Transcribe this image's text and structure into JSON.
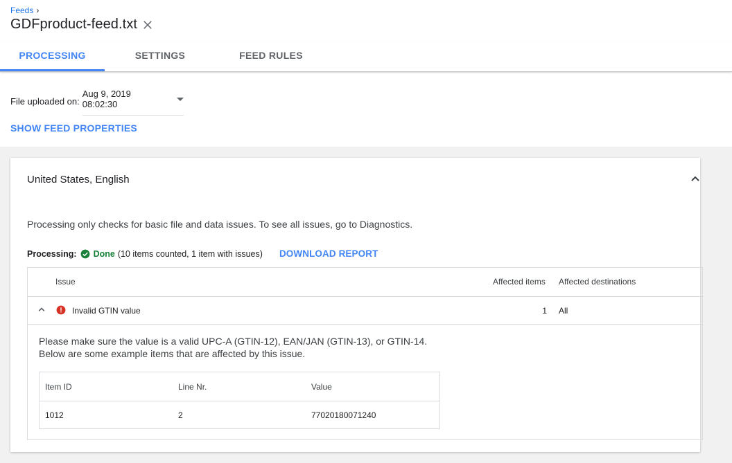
{
  "breadcrumb": {
    "parent": "Feeds",
    "separator": "›"
  },
  "page": {
    "title": "GDFproduct-feed.txt"
  },
  "tabs": [
    {
      "label": "PROCESSING",
      "active": true
    },
    {
      "label": "SETTINGS",
      "active": false
    },
    {
      "label": "FEED RULES",
      "active": false
    }
  ],
  "upload": {
    "label": "File uploaded on:",
    "selected": "Aug 9, 2019 08:02:30"
  },
  "show_properties_label": "SHOW FEED PROPERTIES",
  "card": {
    "title": "United States, English",
    "note": "Processing only checks for basic file and data issues. To see all issues, go to Diagnostics.",
    "processing": {
      "label": "Processing:",
      "status": "Done",
      "summary": "(10 items counted, 1 item with issues)",
      "download_label": "DOWNLOAD REPORT"
    },
    "issues_table": {
      "headers": {
        "issue": "Issue",
        "affected_items": "Affected items",
        "affected_destinations": "Affected destinations"
      },
      "rows": [
        {
          "issue": "Invalid GTIN value",
          "affected_items": "1",
          "affected_destinations": "All",
          "detail_line1": "Please make sure the value is a valid UPC-A (GTIN-12), EAN/JAN (GTIN-13), or GTIN-14.",
          "detail_line2": "Below are some example items that are affected by this issue.",
          "examples": {
            "headers": {
              "item_id": "Item ID",
              "line_nr": "Line Nr.",
              "value": "Value"
            },
            "rows": [
              {
                "item_id": "1012",
                "line_nr": "2",
                "value": "77020180071240"
              }
            ]
          }
        }
      ]
    }
  },
  "colors": {
    "accent": "#4285f4",
    "link": "#1a73e8",
    "success": "#188038",
    "error": "#d93025",
    "background": "#f1f1f1"
  },
  "icons": {
    "close": "close-icon",
    "dropdown": "caret-down-icon",
    "collapse": "chevron-up-icon",
    "status_done": "check-circle-icon",
    "issue_error": "error-icon"
  }
}
